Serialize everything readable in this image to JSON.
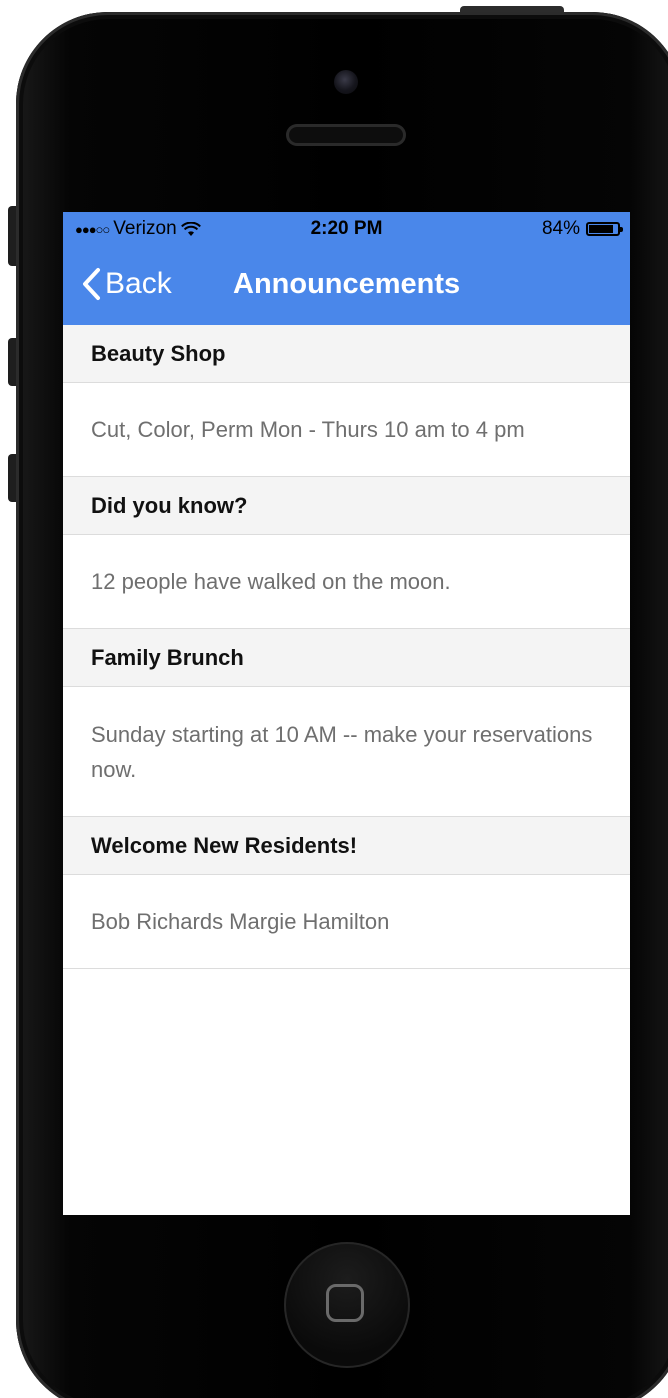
{
  "status_bar": {
    "signal": "●●●○○",
    "carrier": "Verizon",
    "wifi_icon": "wifi-icon",
    "time": "2:20 PM",
    "battery": "84%",
    "battery_level": 0.84
  },
  "nav": {
    "back_label": "Back",
    "title": "Announcements",
    "color": "#4a87ea"
  },
  "announcements": [
    {
      "title": "Beauty Shop",
      "body": "Cut, Color, Perm Mon - Thurs 10 am to 4 pm"
    },
    {
      "title": "Did you know?",
      "body": "12 people have walked on the moon."
    },
    {
      "title": "Family Brunch",
      "body": "Sunday starting at 10 AM -- make your reservations now."
    },
    {
      "title": "Welcome New Residents!",
      "body": "Bob Richards Margie Hamilton"
    }
  ]
}
